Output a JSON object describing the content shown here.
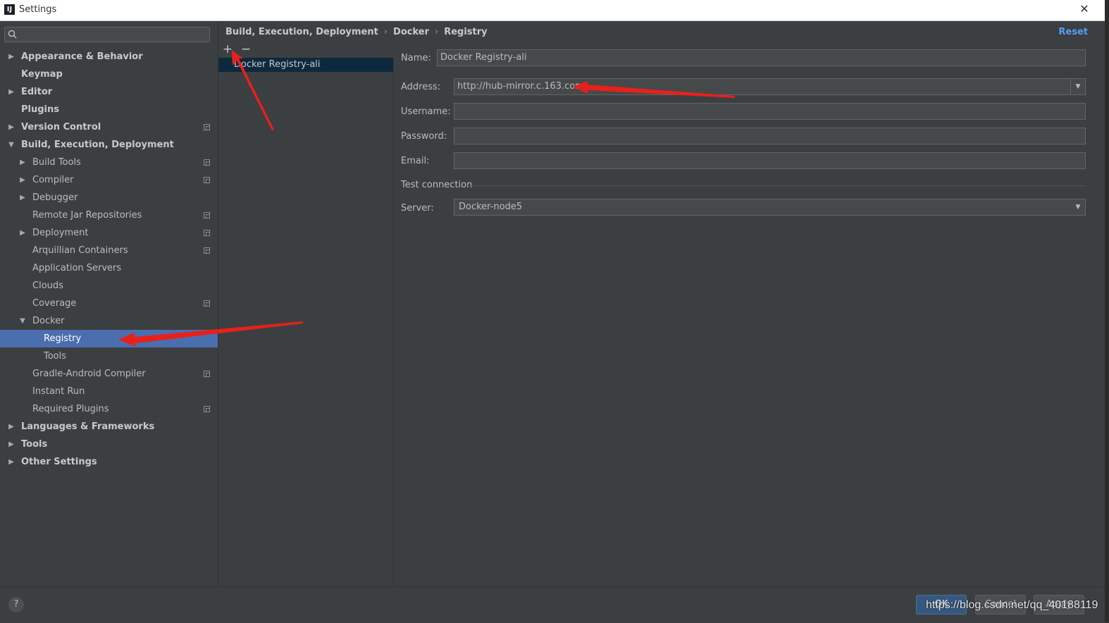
{
  "window": {
    "title": "Settings",
    "app_icon": "intellij-icon",
    "close": "close-icon"
  },
  "search": {
    "placeholder": ""
  },
  "tree": [
    {
      "label": "Appearance & Behavior",
      "level": 0,
      "arrow": "collapsed",
      "bold": true,
      "project": false,
      "selected": false
    },
    {
      "label": "Keymap",
      "level": 0,
      "arrow": "none",
      "bold": true,
      "project": false,
      "selected": false
    },
    {
      "label": "Editor",
      "level": 0,
      "arrow": "collapsed",
      "bold": true,
      "project": false,
      "selected": false
    },
    {
      "label": "Plugins",
      "level": 0,
      "arrow": "none",
      "bold": true,
      "project": false,
      "selected": false
    },
    {
      "label": "Version Control",
      "level": 0,
      "arrow": "collapsed",
      "bold": true,
      "project": true,
      "selected": false
    },
    {
      "label": "Build, Execution, Deployment",
      "level": 0,
      "arrow": "expanded",
      "bold": true,
      "project": false,
      "selected": false
    },
    {
      "label": "Build Tools",
      "level": 1,
      "arrow": "collapsed",
      "bold": false,
      "project": true,
      "selected": false
    },
    {
      "label": "Compiler",
      "level": 1,
      "arrow": "collapsed",
      "bold": false,
      "project": true,
      "selected": false
    },
    {
      "label": "Debugger",
      "level": 1,
      "arrow": "collapsed",
      "bold": false,
      "project": false,
      "selected": false
    },
    {
      "label": "Remote Jar Repositories",
      "level": 1,
      "arrow": "none",
      "bold": false,
      "project": true,
      "selected": false
    },
    {
      "label": "Deployment",
      "level": 1,
      "arrow": "collapsed",
      "bold": false,
      "project": true,
      "selected": false
    },
    {
      "label": "Arquillian Containers",
      "level": 1,
      "arrow": "none",
      "bold": false,
      "project": true,
      "selected": false
    },
    {
      "label": "Application Servers",
      "level": 1,
      "arrow": "none",
      "bold": false,
      "project": false,
      "selected": false
    },
    {
      "label": "Clouds",
      "level": 1,
      "arrow": "none",
      "bold": false,
      "project": false,
      "selected": false
    },
    {
      "label": "Coverage",
      "level": 1,
      "arrow": "none",
      "bold": false,
      "project": true,
      "selected": false
    },
    {
      "label": "Docker",
      "level": 1,
      "arrow": "expanded",
      "bold": false,
      "project": false,
      "selected": false
    },
    {
      "label": "Registry",
      "level": 2,
      "arrow": "none",
      "bold": false,
      "project": false,
      "selected": true
    },
    {
      "label": "Tools",
      "level": 2,
      "arrow": "none",
      "bold": false,
      "project": false,
      "selected": false
    },
    {
      "label": "Gradle-Android Compiler",
      "level": 1,
      "arrow": "none",
      "bold": false,
      "project": true,
      "selected": false
    },
    {
      "label": "Instant Run",
      "level": 1,
      "arrow": "none",
      "bold": false,
      "project": false,
      "selected": false
    },
    {
      "label": "Required Plugins",
      "level": 1,
      "arrow": "none",
      "bold": false,
      "project": true,
      "selected": false
    },
    {
      "label": "Languages & Frameworks",
      "level": 0,
      "arrow": "collapsed",
      "bold": true,
      "project": false,
      "selected": false
    },
    {
      "label": "Tools",
      "level": 0,
      "arrow": "collapsed",
      "bold": true,
      "project": false,
      "selected": false
    },
    {
      "label": "Other Settings",
      "level": 0,
      "arrow": "collapsed",
      "bold": true,
      "project": false,
      "selected": false
    }
  ],
  "breadcrumb": [
    "Build, Execution, Deployment",
    "Docker",
    "Registry"
  ],
  "reset_label": "Reset",
  "toolbar": {
    "add": "+",
    "remove": "−"
  },
  "registries": [
    "Docker Registry-ali"
  ],
  "form": {
    "name_label": "Name:",
    "name_value": "Docker Registry-ali",
    "address_label": "Address:",
    "address_value": "http://hub-mirror.c.163.com",
    "username_label": "Username:",
    "username_value": "",
    "password_label": "Password:",
    "password_value": "",
    "email_label": "Email:",
    "email_value": "",
    "section_title": "Test connection",
    "server_label": "Server:",
    "server_value": "Docker-node5"
  },
  "buttons": {
    "ok": "OK",
    "cancel": "Cancel",
    "apply": "Apply",
    "help": "?"
  },
  "watermark": "https://blog.csdn.net/qq_40188119",
  "colors": {
    "background": "#3c3f41",
    "selection": "#4b6eaf",
    "accent_link": "#589df6",
    "annotation_arrow": "#e8201c"
  }
}
